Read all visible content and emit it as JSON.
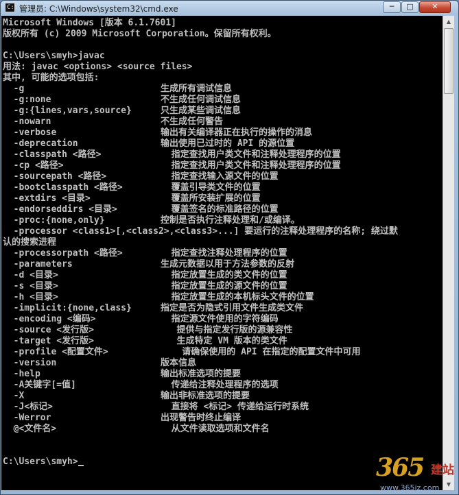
{
  "window": {
    "title": "管理员: C:\\Windows\\system32\\cmd.exe",
    "icon_text": "C:\\",
    "controls": {
      "minimize": "─",
      "maximize": "□",
      "close": "✕"
    }
  },
  "console": {
    "lines": [
      [
        "Microsoft Windows [版本 6.1.7601]",
        ""
      ],
      [
        "版权所有 (c) 2009 Microsoft Corporation。保留所有权利。",
        ""
      ],
      [
        "",
        ""
      ],
      [
        "C:\\Users\\smyh>javac",
        ""
      ],
      [
        "用法: javac <options> <source files>",
        ""
      ],
      [
        "其中, 可能的选项包括:",
        ""
      ],
      [
        "  -g",
        "生成所有调试信息"
      ],
      [
        "  -g:none",
        "不生成任何调试信息"
      ],
      [
        "  -g:{lines,vars,source}",
        "只生成某些调试信息"
      ],
      [
        "  -nowarn",
        "不生成任何警告"
      ],
      [
        "  -verbose",
        "输出有关编译器正在执行的操作的消息"
      ],
      [
        "  -deprecation",
        "输出使用已过时的 API 的源位置"
      ],
      [
        "  -classpath <路径>",
        "  指定查找用户类文件和注释处理程序的位置"
      ],
      [
        "  -cp <路径>",
        "  指定查找用户类文件和注释处理程序的位置"
      ],
      [
        "  -sourcepath <路径>",
        "  指定查找输入源文件的位置"
      ],
      [
        "  -bootclasspath <路径>",
        "  覆盖引导类文件的位置"
      ],
      [
        "  -extdirs <目录>",
        "  覆盖所安装扩展的位置"
      ],
      [
        "  -endorseddirs <目录>",
        "  覆盖签名的标准路径的位置"
      ],
      [
        "  -proc:{none,only}",
        "控制是否执行注释处理和/或编译。"
      ],
      [
        "  -processor <class1>[,<class2>,<class3>...] 要运行的注释处理程序的名称; 绕过默",
        ""
      ],
      [
        "认的搜索进程",
        ""
      ],
      [
        "  -processorpath <路径>",
        "  指定查找注释处理程序的位置"
      ],
      [
        "  -parameters",
        "生成元数据以用于方法参数的反射"
      ],
      [
        "  -d <目录>",
        "  指定放置生成的类文件的位置"
      ],
      [
        "  -s <目录>",
        "  指定放置生成的源文件的位置"
      ],
      [
        "  -h <目录>",
        "  指定放置生成的本机标头文件的位置"
      ],
      [
        "  -implicit:{none,class}",
        "指定是否为隐式引用文件生成类文件"
      ],
      [
        "  -encoding <编码>",
        "  指定源文件使用的字符编码"
      ],
      [
        "  -source <发行版>",
        "   提供与指定发行版的源兼容性"
      ],
      [
        "  -target <发行版>",
        "   生成特定 VM 版本的类文件"
      ],
      [
        "  -profile <配置文件>",
        "    请确保使用的 API 在指定的配置文件中可用"
      ],
      [
        "  -version",
        "版本信息"
      ],
      [
        "  -help",
        "输出标准选项的提要"
      ],
      [
        "  -A关键字[=值]",
        "  传递给注释处理程序的选项"
      ],
      [
        "  -X",
        "输出非标准选项的提要"
      ],
      [
        "  -J<标记>",
        "  直接将 <标记> 传递给运行时系统"
      ],
      [
        "  -Werror",
        "出现警告时终止编译"
      ],
      [
        "  @<文件名>",
        "  从文件读取选项和文件名"
      ],
      [
        "",
        ""
      ],
      [
        "",
        ""
      ],
      [
        "C:\\Users\\smyh>",
        ""
      ]
    ]
  },
  "watermark": {
    "number": "365",
    "brand": "建站",
    "url": "www.365jz.com"
  }
}
